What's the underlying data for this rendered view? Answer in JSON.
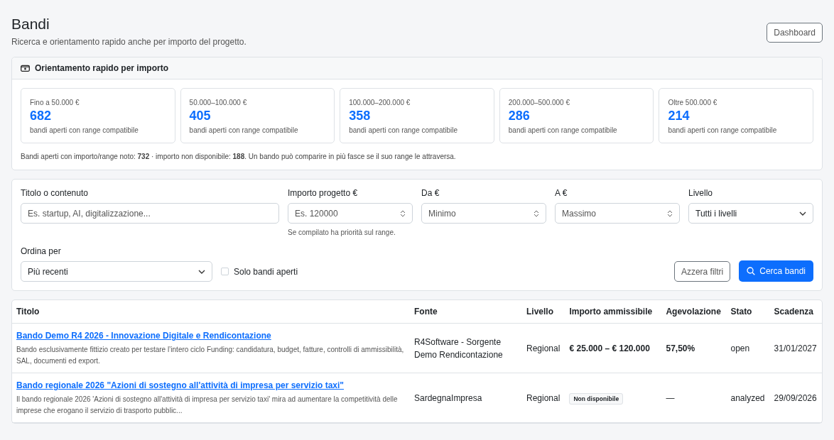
{
  "page": {
    "title": "Bandi",
    "subtitle": "Ricerca e orientamento rapido anche per importo del progetto.",
    "dashboard_button": "Dashboard"
  },
  "orientation": {
    "title": "Orientamento rapido per importo",
    "ranges": [
      {
        "label": "Fino a 50.000 €",
        "count": "682",
        "caption": "bandi aperti con range compatibile"
      },
      {
        "label": "50.000–100.000 €",
        "count": "405",
        "caption": "bandi aperti con range compatibile"
      },
      {
        "label": "100.000–200.000 €",
        "count": "358",
        "caption": "bandi aperti con range compatibile"
      },
      {
        "label": "200.000–500.000 €",
        "count": "286",
        "caption": "bandi aperti con range compatibile"
      },
      {
        "label": "Oltre 500.000 €",
        "count": "214",
        "caption": "bandi aperti con range compatibile"
      }
    ],
    "note": "Bandi aperti con importo/range noto: **732** · importo non disponibile: **188**. Un bando può comparire in più fasce se il suo range le attraversa."
  },
  "filters": {
    "text": {
      "label": "Titolo o contenuto",
      "placeholder": "Es. startup, AI, digitalizzazione..."
    },
    "amount": {
      "label": "Importo progetto €",
      "placeholder": "Es. 120000",
      "help": "Se compilato ha priorità sul range."
    },
    "from": {
      "label": "Da €",
      "placeholder": "Minimo"
    },
    "to": {
      "label": "A €",
      "placeholder": "Massimo"
    },
    "level": {
      "label": "Livello",
      "value": "Tutti i livelli"
    },
    "sort": {
      "label": "Ordina per",
      "value": "Più recenti"
    },
    "only_open": {
      "label": "Solo bandi aperti",
      "checked": false
    },
    "reset_button": "Azzera filtri",
    "search_button": "Cerca bandi"
  },
  "table": {
    "columns": [
      "Titolo",
      "Fonte",
      "Livello",
      "Importo ammissibile",
      "Agevolazione",
      "Stato",
      "Scadenza"
    ],
    "rows": [
      {
        "title": "Bando Demo R4 2026 - Innovazione Digitale e Rendicontazione",
        "description": "Bando esclusivamente fittizio creato per testare l’intero ciclo Funding: candidatura, budget, fatture, controlli di ammissibilità, SAL, documenti ed export.",
        "source": "R4Software - Sorgente Demo Rendicontazione",
        "level": "Regional",
        "amount": {
          "kind": "value",
          "text": "€ 25.000 – € 120.000"
        },
        "benefit": {
          "kind": "value",
          "text": "57,50%"
        },
        "status": "open",
        "deadline": "31/01/2027"
      },
      {
        "title": "Bando regionale 2026 \"Azioni di sostegno all'attività di impresa per servizio taxi\"",
        "description": "Il bando regionale 2026 'Azioni di sostegno all'attività di impresa per servizio taxi' mira ad aumentare la competitività delle imprese che erogano il servizio di trasporto pubblic...",
        "source": "SardegnaImpresa",
        "level": "Regional",
        "amount": {
          "kind": "badge",
          "text": "Non disponibile"
        },
        "benefit": {
          "kind": "plain",
          "text": "—"
        },
        "status": "analyzed",
        "deadline": "29/09/2026"
      }
    ]
  }
}
